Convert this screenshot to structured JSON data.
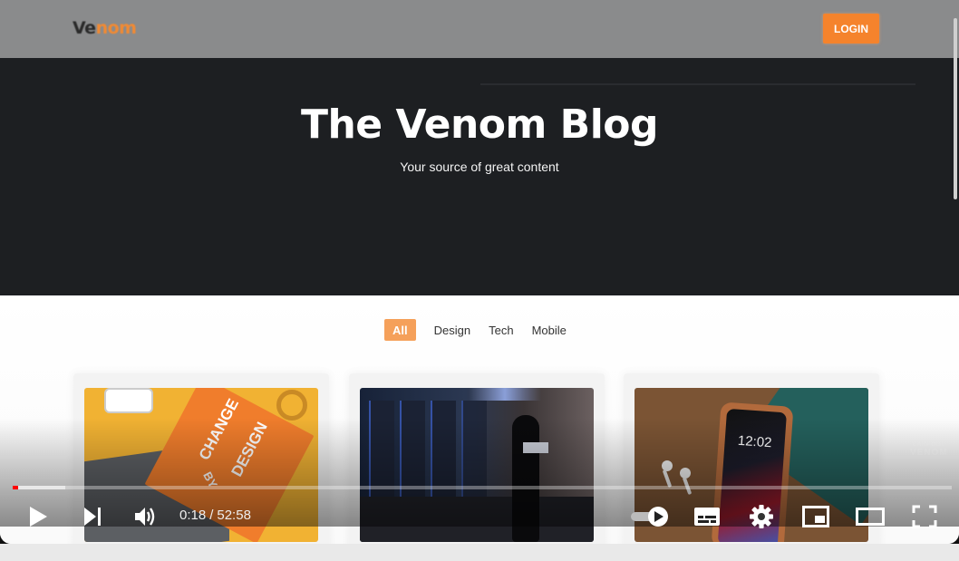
{
  "site": {
    "logo_part1": "Ve",
    "logo_part2": "nom",
    "login_label": "LOGIN"
  },
  "hero": {
    "title": "The Venom Blog",
    "subtitle": "Your source of great content"
  },
  "filters": [
    {
      "label": "All",
      "active": true
    },
    {
      "label": "Design",
      "active": false
    },
    {
      "label": "Tech",
      "active": false
    },
    {
      "label": "Mobile",
      "active": false
    }
  ],
  "cards": [
    {
      "image": "change-by-design-book-image",
      "text_line1": "CHANGE",
      "text_line2": "DESIGN",
      "text_line3": "BY"
    },
    {
      "image": "server-room-person-laptop-image"
    },
    {
      "image": "iphone-airpods-image",
      "clock": "12:02"
    }
  ],
  "watermark": {
    "line1": "CARPOOL",
    "line2": "VENOM"
  },
  "player": {
    "current_time": "0:18",
    "separator": "/",
    "duration": "52:58",
    "played_fraction": 0.0057,
    "loaded_fraction": 0.056,
    "accent_color": "#ff0000",
    "icons": [
      "play-icon",
      "next-icon",
      "volume-icon",
      "autoplay-toggle-icon",
      "subtitles-icon",
      "settings-icon",
      "miniplayer-icon",
      "theater-mode-icon",
      "fullscreen-icon"
    ]
  },
  "colors": {
    "brand_orange": "#f5832c",
    "hero_bg": "#1d1f22",
    "nav_bg": "#8a8b8c"
  }
}
